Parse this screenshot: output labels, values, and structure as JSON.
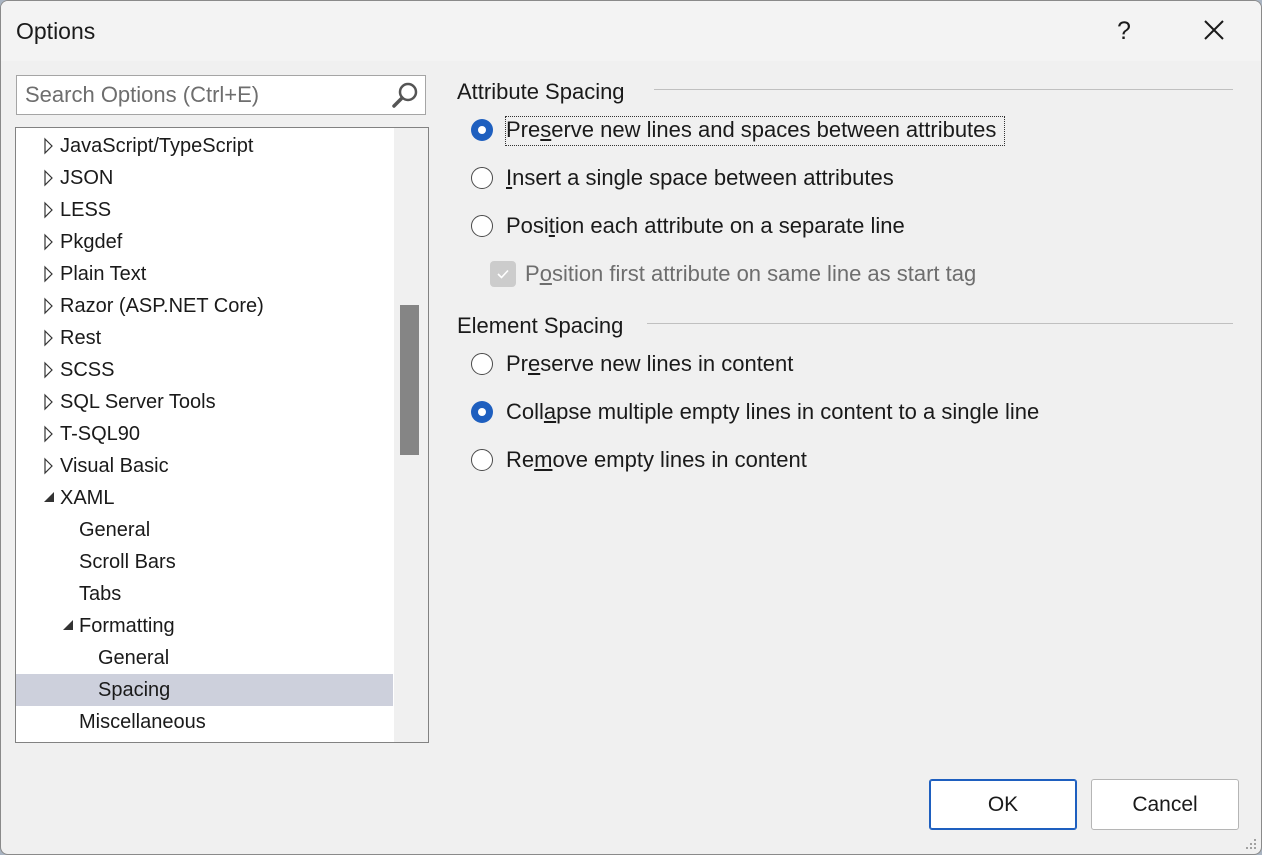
{
  "window": {
    "title": "Options",
    "help_glyph": "?"
  },
  "search": {
    "placeholder": "Search Options (Ctrl+E)"
  },
  "tree": {
    "items": [
      {
        "label": "JavaScript/TypeScript",
        "state": "collapsed",
        "level": 0
      },
      {
        "label": "JSON",
        "state": "collapsed",
        "level": 0
      },
      {
        "label": "LESS",
        "state": "collapsed",
        "level": 0
      },
      {
        "label": "Pkgdef",
        "state": "collapsed",
        "level": 0
      },
      {
        "label": "Plain Text",
        "state": "collapsed",
        "level": 0
      },
      {
        "label": "Razor (ASP.NET Core)",
        "state": "collapsed",
        "level": 0
      },
      {
        "label": "Rest",
        "state": "collapsed",
        "level": 0
      },
      {
        "label": "SCSS",
        "state": "collapsed",
        "level": 0
      },
      {
        "label": "SQL Server Tools",
        "state": "collapsed",
        "level": 0
      },
      {
        "label": "T-SQL90",
        "state": "collapsed",
        "level": 0
      },
      {
        "label": "Visual Basic",
        "state": "collapsed",
        "level": 0
      },
      {
        "label": "XAML",
        "state": "expanded",
        "level": 0
      },
      {
        "label": "General",
        "state": "leaf",
        "level": 1
      },
      {
        "label": "Scroll Bars",
        "state": "leaf",
        "level": 1
      },
      {
        "label": "Tabs",
        "state": "leaf",
        "level": 1
      },
      {
        "label": "Formatting",
        "state": "expanded",
        "level": 1
      },
      {
        "label": "General",
        "state": "leaf",
        "level": 2
      },
      {
        "label": "Spacing",
        "state": "leaf",
        "level": 2,
        "selected": true
      },
      {
        "label": "Miscellaneous",
        "state": "leaf",
        "level": 1
      }
    ]
  },
  "attribute_spacing": {
    "title": "Attribute Spacing",
    "options": [
      {
        "pre": "Pre",
        "key": "s",
        "post": "erve new lines and spaces between attributes",
        "checked": true
      },
      {
        "pre": "",
        "key": "I",
        "post": "nsert a single space between attributes",
        "checked": false
      },
      {
        "pre": "Posi",
        "key": "t",
        "post": "ion each attribute on a separate line",
        "checked": false
      }
    ],
    "sub_checkbox": {
      "pre": "P",
      "key": "o",
      "post": "sition first attribute on same line as start tag",
      "checked": true,
      "enabled": false
    }
  },
  "element_spacing": {
    "title": "Element Spacing",
    "options": [
      {
        "pre": "Pr",
        "key": "e",
        "post": "serve new lines in content",
        "checked": false
      },
      {
        "pre": "Coll",
        "key": "a",
        "post": "pse multiple empty lines in content to a single line",
        "checked": true
      },
      {
        "pre": "Re",
        "key": "m",
        "post": "ove empty lines in content",
        "checked": false
      }
    ]
  },
  "buttons": {
    "ok": "OK",
    "cancel": "Cancel"
  },
  "colors": {
    "accent": "#1e5fbf",
    "selection": "#cdd0dc",
    "background": "#f0f0f0"
  }
}
